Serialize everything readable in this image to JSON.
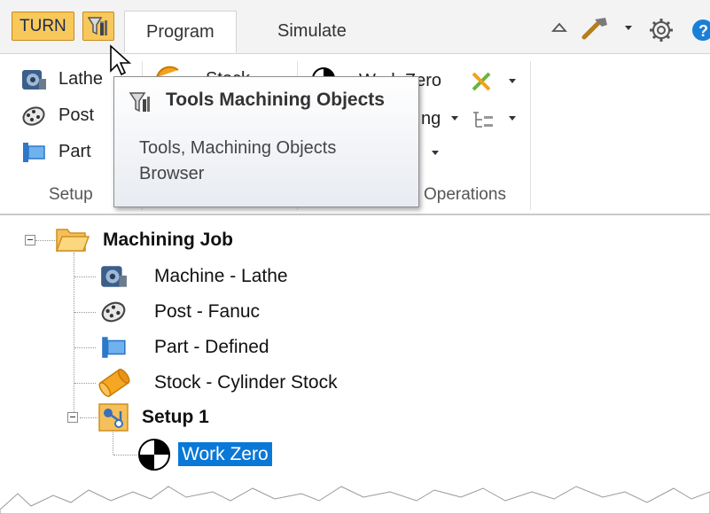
{
  "tabbar": {
    "turn_label": "TURN",
    "tabs": [
      {
        "label": "Program",
        "active": true
      },
      {
        "label": "Simulate",
        "active": false
      }
    ]
  },
  "ribbon": {
    "setup": {
      "items": [
        {
          "label": "Lathe",
          "icon": "lathe-machine-icon"
        },
        {
          "label": "Post",
          "icon": "post-processor-icon"
        },
        {
          "label": "Part",
          "icon": "part-icon"
        }
      ],
      "group_label": "Setup"
    },
    "mid": {
      "stock_partial": "Stock",
      "work_zero": "Work Zero",
      "partial_ing": "ng",
      "operations_label": "Operations"
    }
  },
  "tooltip": {
    "title": "Tools  Machining Objects",
    "description": "Tools, Machining Objects Browser"
  },
  "tree": {
    "root": {
      "label": "Machining Job"
    },
    "children": [
      {
        "label": "Machine - Lathe",
        "icon": "lathe-machine-icon"
      },
      {
        "label": "Post - Fanuc",
        "icon": "post-processor-icon"
      },
      {
        "label": "Part - Defined",
        "icon": "part-icon"
      },
      {
        "label": "Stock - Cylinder Stock",
        "icon": "cylinder-stock-icon"
      }
    ],
    "setup": {
      "label": "Setup 1"
    },
    "setup_children": [
      {
        "label": "Work Zero",
        "selected": true
      }
    ]
  },
  "colors": {
    "accent_orange": "#f8c85a",
    "selection_blue": "#0a78d7",
    "help_blue": "#1a7fd8"
  }
}
